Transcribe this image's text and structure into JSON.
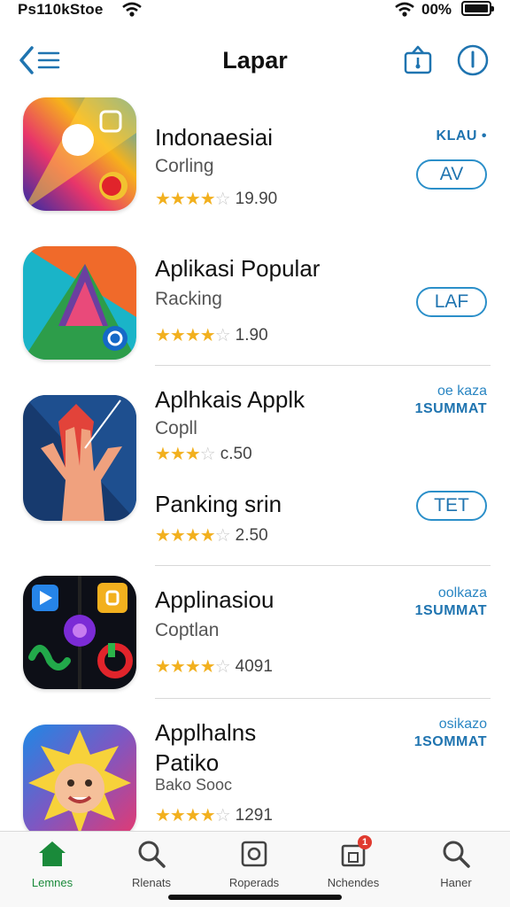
{
  "status": {
    "carrier": "Ps110kStoe",
    "battery": "00%"
  },
  "nav": {
    "title": "Lapar",
    "back_icon": "back-list-icon",
    "share_icon": "share-icon",
    "info_icon": "info-icon"
  },
  "apps": [
    {
      "name": "Indonaesiai",
      "subtitle": "Corling",
      "score": "19.90",
      "rating": 4.5,
      "button": "AV",
      "tag1": "KLAU •",
      "tag2": ""
    },
    {
      "name": "Aplikasi Popular",
      "subtitle": "Racking",
      "score": "1.90",
      "rating": 4.5,
      "button": "LAF",
      "tag1": "",
      "tag2": ""
    },
    {
      "name": "Aplhkais Applk",
      "subtitle": "Copll",
      "score": "c.50",
      "rating": 3.5,
      "button": "",
      "tag1": "oe kaza",
      "tag2": "1SUMMAT"
    },
    {
      "name": "Panking srin",
      "subtitle": "",
      "score": "2.50",
      "rating": 4.5,
      "button": "TET",
      "tag1": "",
      "tag2": ""
    },
    {
      "name": "Applinasiou",
      "subtitle": "Coptlan",
      "score": "4091",
      "rating": 4.5,
      "button": "",
      "tag1": "oolkaza",
      "tag2": "1SUMMAT"
    },
    {
      "name": "Applhalns",
      "name2": "Patiko",
      "subtitle": "Bako Sooc",
      "score": "1291",
      "rating": 4.5,
      "button": "",
      "tag1": "osikazo",
      "tag2": "1SOMMAT"
    }
  ],
  "tabs": [
    {
      "label": "Lemnes",
      "icon": "home-icon",
      "active": true
    },
    {
      "label": "Rlenats",
      "icon": "search-icon",
      "active": false
    },
    {
      "label": "Roperads",
      "icon": "record-icon",
      "active": false
    },
    {
      "label": "Nchendes",
      "icon": "bag-icon",
      "active": false,
      "badge": "1"
    },
    {
      "label": "Haner",
      "icon": "search-icon",
      "active": false
    }
  ],
  "colors": {
    "accent": "#1f74b0",
    "star": "#f2b01e",
    "active_tab": "#1a8a3a",
    "badge": "#e03a2f"
  }
}
